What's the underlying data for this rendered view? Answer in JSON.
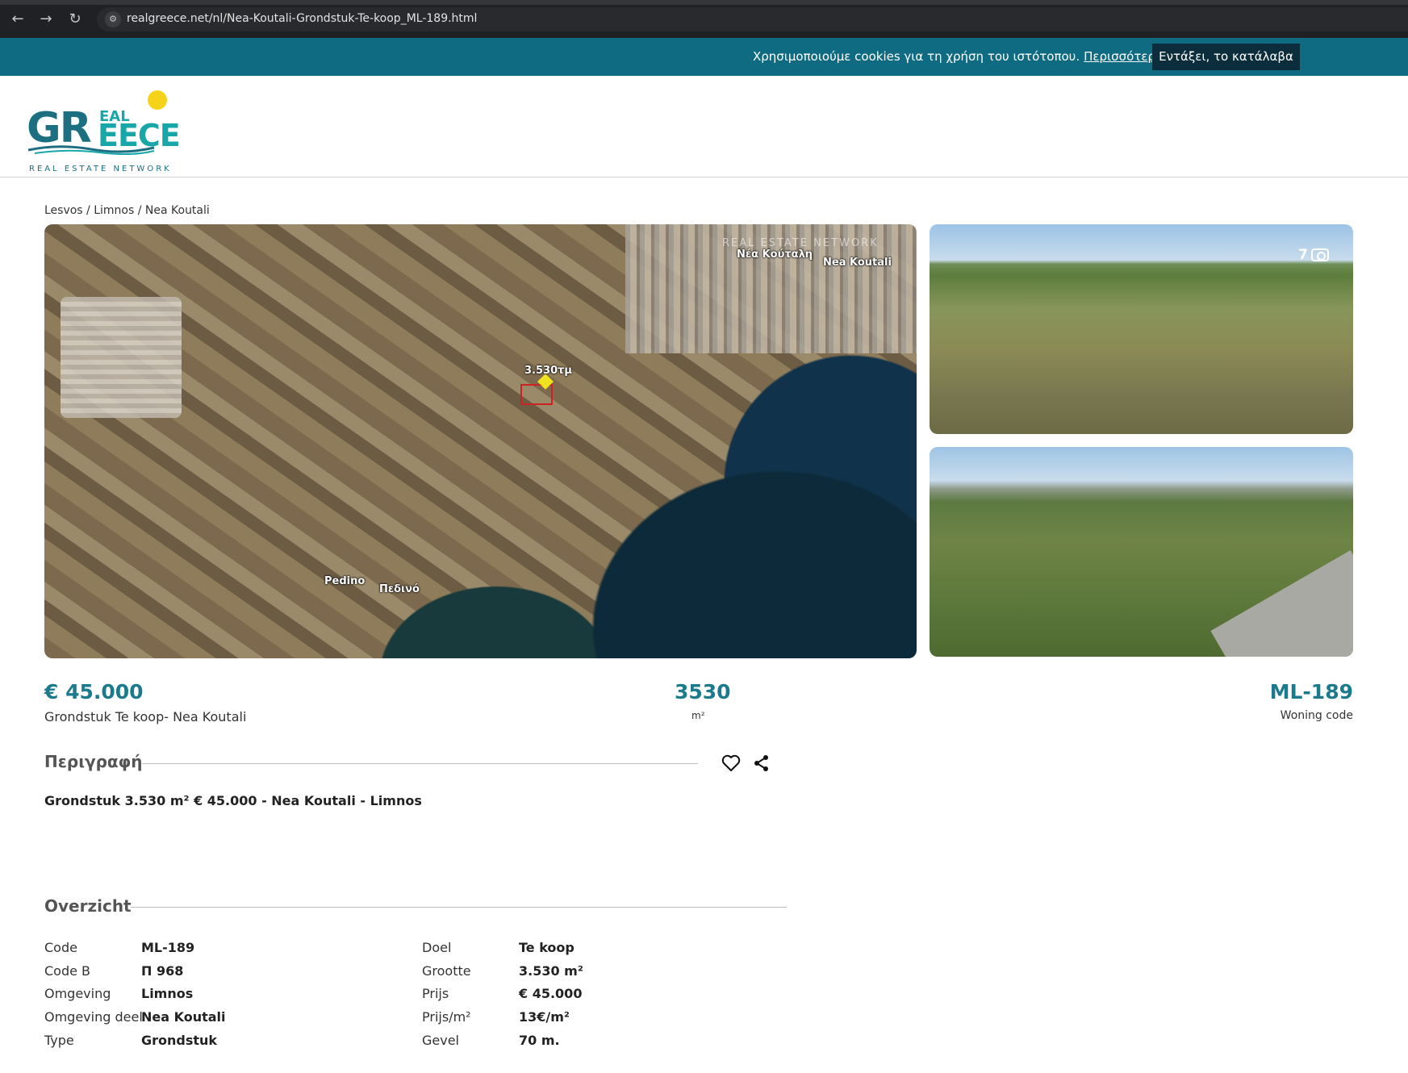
{
  "browser": {
    "url": "realgreece.net/nl/Nea-Koutali-Grondstuk-Te-koop_ML-189.html"
  },
  "cookie": {
    "text": "Χρησιμοποιούμε cookies για τη χρήση του ιστότοπου.",
    "link": "Περισσότερα",
    "button": "Εντάξει, το κατάλαβα"
  },
  "logo": {
    "g": "G",
    "r": "R",
    "eal": "EAL",
    "eece": "EECE",
    "tagline": "REAL ESTATE NETWORK"
  },
  "breadcrumb": "Lesvos / Limnos / Nea Koutali",
  "map": {
    "watermark": "REAL ESTATE NETWORK",
    "label_town_gr": "Νέα Κούταλη",
    "label_town_en": "Nea Koutali",
    "label_plot": "3.530τμ",
    "label_village_en": "Pedino",
    "label_village_gr": "Πεδινό"
  },
  "gallery": {
    "photo_count": "7"
  },
  "summary": {
    "price": "€ 45.000",
    "subtitle": "Grondstuk Te koop- Nea Koutali",
    "area": "3530",
    "area_unit": "m²",
    "code": "ML-189",
    "code_label": "Woning code"
  },
  "description": {
    "heading": "Περιγραφή",
    "text": "Grondstuk 3.530 m² € 45.000 - Nea Koutali - Limnos"
  },
  "overview": {
    "heading": "Overzicht",
    "left": [
      {
        "label": "Code",
        "value": "ML-189"
      },
      {
        "label": "Code B",
        "value": "Π 968"
      },
      {
        "label": "Omgeving",
        "value": "Limnos"
      },
      {
        "label": "Omgeving deel",
        "value": "Nea Koutali"
      },
      {
        "label": "Type",
        "value": "Grondstuk"
      }
    ],
    "right": [
      {
        "label": "Doel",
        "value": "Te koop"
      },
      {
        "label": "Grootte",
        "value": "3.530 m²"
      },
      {
        "label": "Prijs",
        "value": "€ 45.000"
      },
      {
        "label": "Prijs/m²",
        "value": "13€/m²"
      },
      {
        "label": "Gevel",
        "value": "70 m."
      }
    ]
  },
  "colors": {
    "accent": "#1b7a8c",
    "cookie_bar": "#0f6b82",
    "cookie_button": "#0c2d3c"
  }
}
